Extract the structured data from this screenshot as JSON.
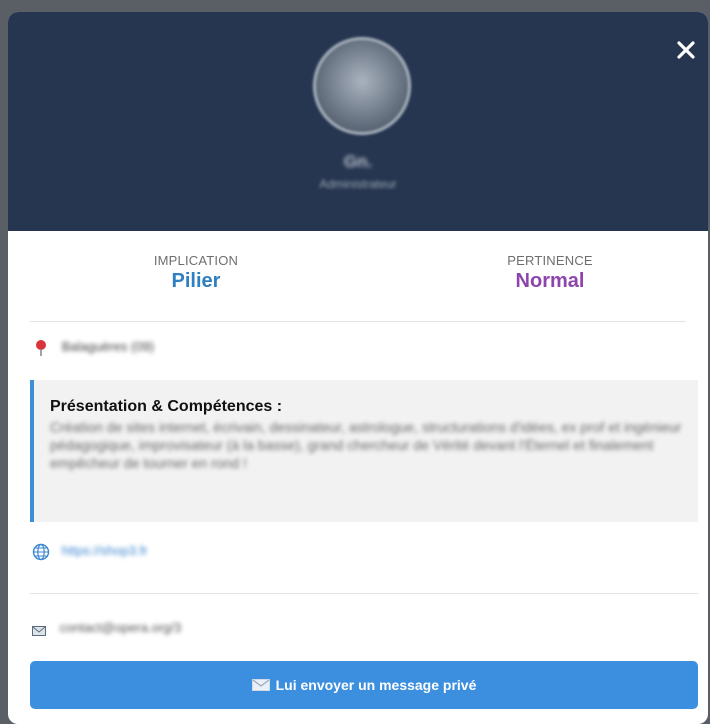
{
  "header": {
    "name": "Gn.",
    "role": "Administrateur"
  },
  "stats": {
    "implication_label": "IMPLICATION",
    "implication_value": "Pilier",
    "pertinence_label": "PERTINENCE",
    "pertinence_value": "Normal"
  },
  "profile": {
    "location": "Balaguères (09)",
    "presentation_title": "Présentation & Compétences :",
    "presentation_text": "Création de sites internet, écrivain, dessinateur, astrologue, structurations d'idées, ex prof et ingénieur pédagogique, improvisateur (à la basse), grand chercheur de Vérité devant l'Éternel et finalement empêcheur de tourner en rond !",
    "website": "https://shop3.fr",
    "email": "contact@opera.org/3"
  },
  "actions": {
    "message_button": "Lui envoyer un message privé"
  },
  "colors": {
    "header_bg": "#263650",
    "implication": "#2f7fc1",
    "pertinence": "#8e44ad",
    "accent": "#3b8fde"
  }
}
